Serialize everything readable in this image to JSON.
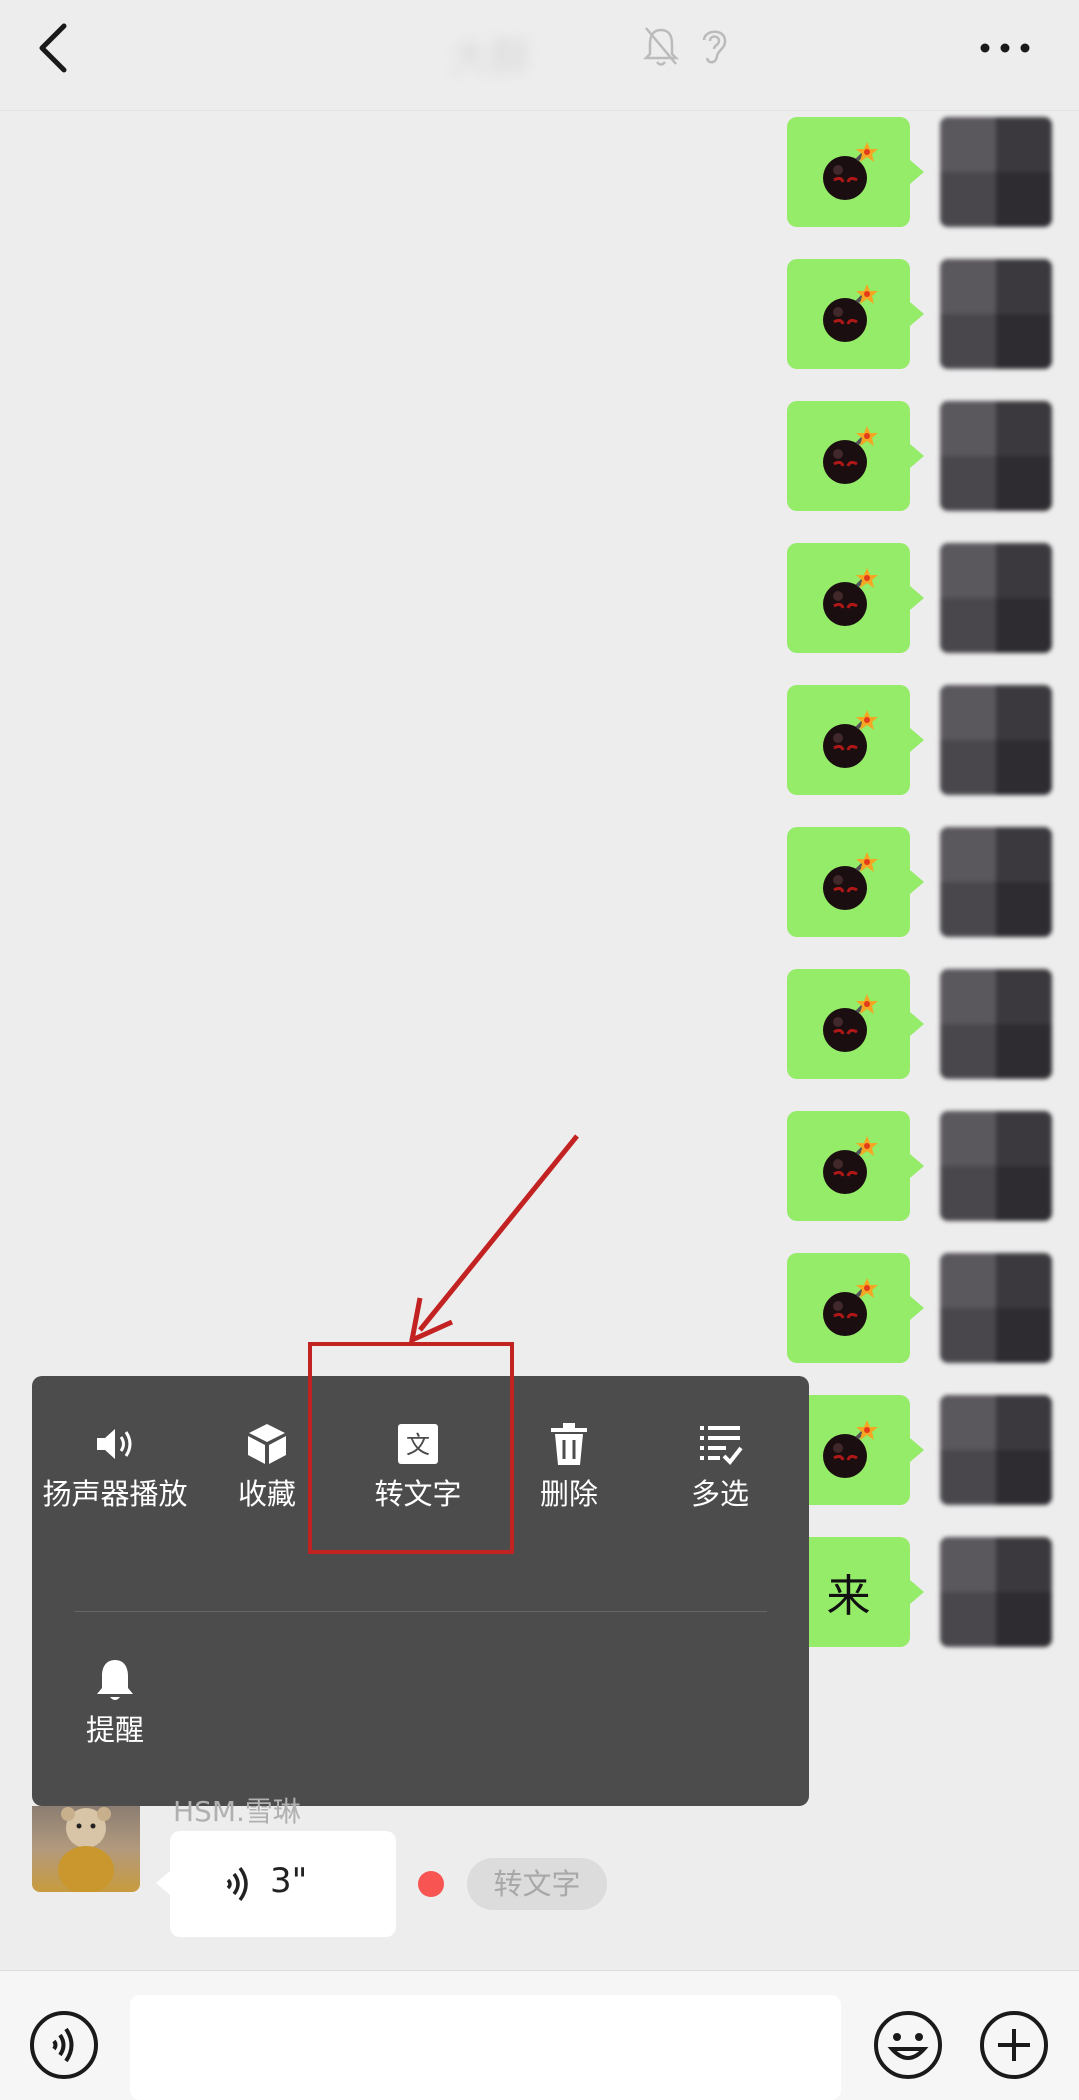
{
  "header": {
    "title": "大群",
    "icons": [
      "back-icon",
      "mute-bell-icon",
      "ear-icon",
      "more-icon"
    ]
  },
  "messages": [
    {
      "type": "emoji",
      "emoji": "bomb"
    },
    {
      "type": "emoji",
      "emoji": "bomb"
    },
    {
      "type": "emoji",
      "emoji": "bomb"
    },
    {
      "type": "emoji",
      "emoji": "bomb"
    },
    {
      "type": "emoji",
      "emoji": "bomb"
    },
    {
      "type": "emoji",
      "emoji": "bomb"
    },
    {
      "type": "emoji",
      "emoji": "bomb"
    },
    {
      "type": "emoji",
      "emoji": "bomb"
    },
    {
      "type": "emoji",
      "emoji": "bomb"
    },
    {
      "type": "emoji",
      "emoji": "bomb"
    },
    {
      "type": "text",
      "text": "来"
    }
  ],
  "context_menu": {
    "speaker": "扬声器播放",
    "favorite": "收藏",
    "transcribe": "转文字",
    "delete": "删除",
    "multiselect": "多选",
    "remind": "提醒"
  },
  "voice_message": {
    "sender": "HSM.雪琳",
    "duration": "3\"",
    "transcribe_chip": "转文字"
  },
  "colors": {
    "sent_bubble": "#95ec69",
    "menu_bg": "#4c4c4c",
    "annotation": "#c32222",
    "unread_dot": "#f75452"
  }
}
